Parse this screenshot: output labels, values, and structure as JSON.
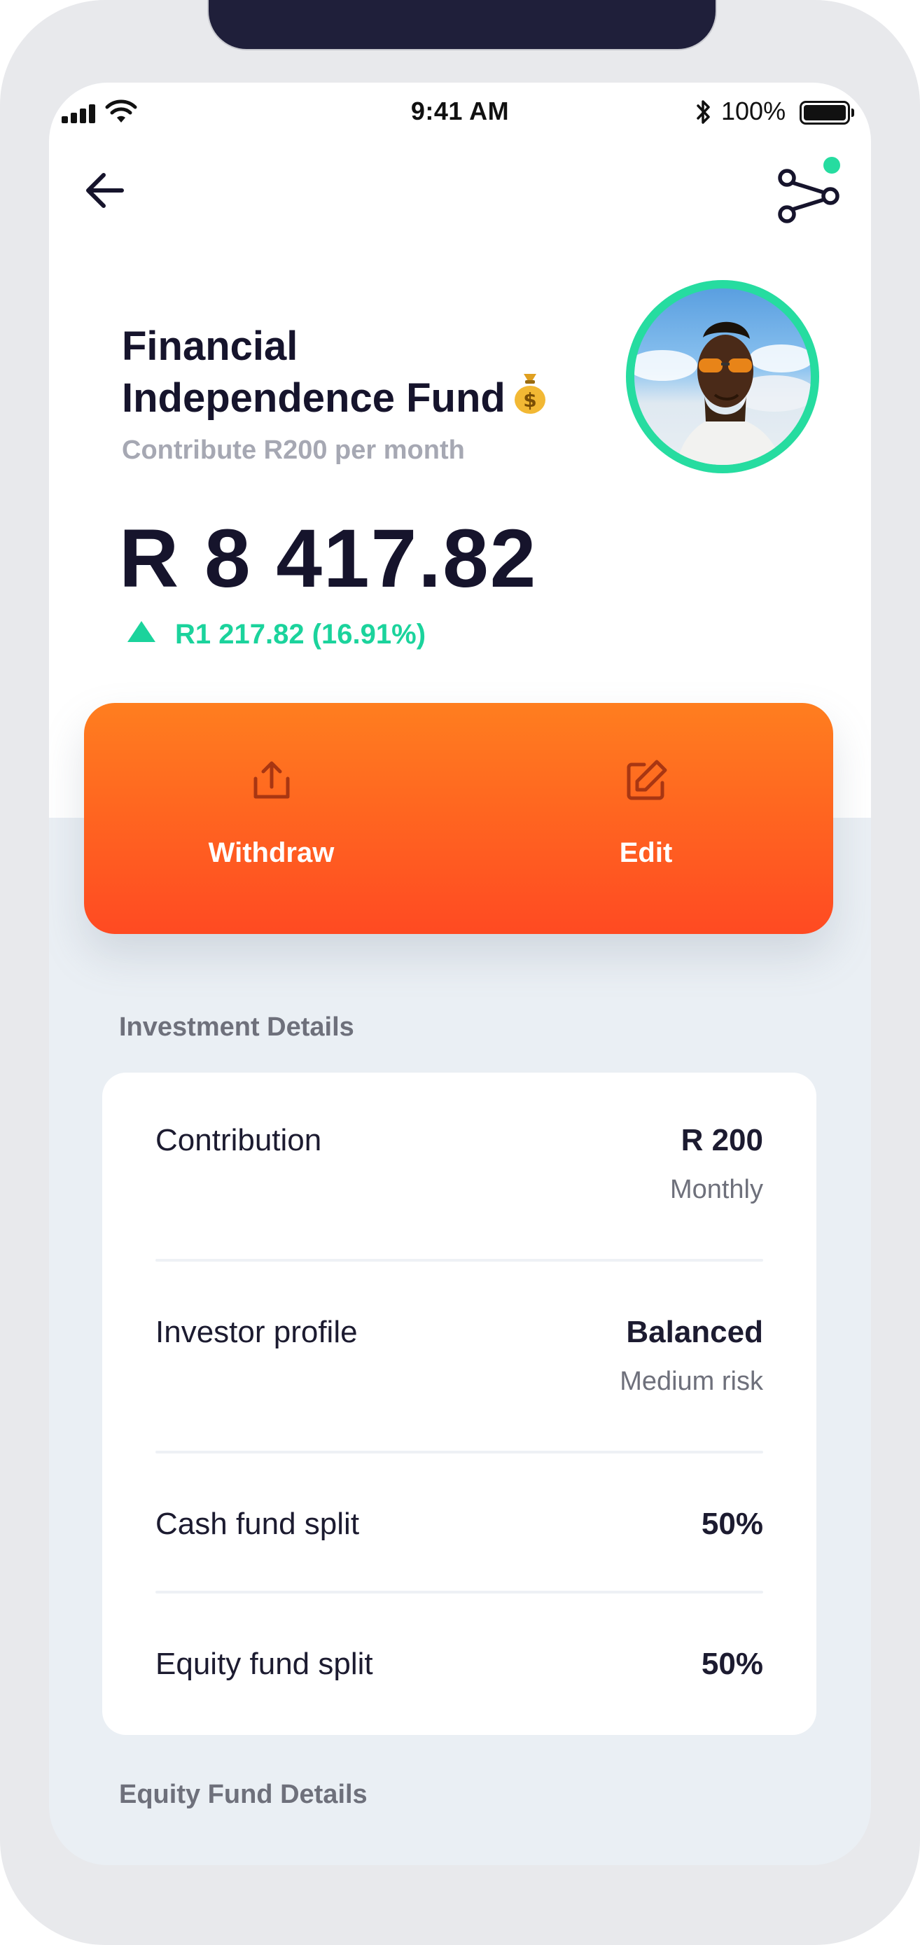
{
  "status_bar": {
    "time": "9:41 AM",
    "battery": "100%",
    "icons": [
      "signal-icon",
      "wifi-icon",
      "bluetooth-icon",
      "battery-icon"
    ]
  },
  "nav": {
    "back_icon": "arrow-left-icon",
    "share_icon": "share-icon",
    "share_badge_color": "#26dca0"
  },
  "fund": {
    "title_line1": "Financial",
    "title_line2": "Independence Fund",
    "emoji": "money-bag-icon",
    "subtitle": "Contribute R200 per month",
    "balance": "R 8 417.82",
    "change": "R1 217.82 (16.91%)",
    "change_direction": "up",
    "accent_color": "#1bd39c"
  },
  "actions": {
    "withdraw_label": "Withdraw",
    "edit_label": "Edit",
    "gradient_top": "#ff7e1f",
    "gradient_bottom": "#ff4a22"
  },
  "investment_details": {
    "heading": "Investment Details",
    "rows": [
      {
        "label": "Contribution",
        "value": "R 200",
        "sub": "Monthly"
      },
      {
        "label": "Investor profile",
        "value": "Balanced",
        "sub": "Medium risk"
      },
      {
        "label": "Cash fund split",
        "value": "50%",
        "sub": ""
      },
      {
        "label": "Equity fund split",
        "value": "50%",
        "sub": ""
      }
    ]
  },
  "equity_details": {
    "heading": "Equity Fund Details"
  }
}
